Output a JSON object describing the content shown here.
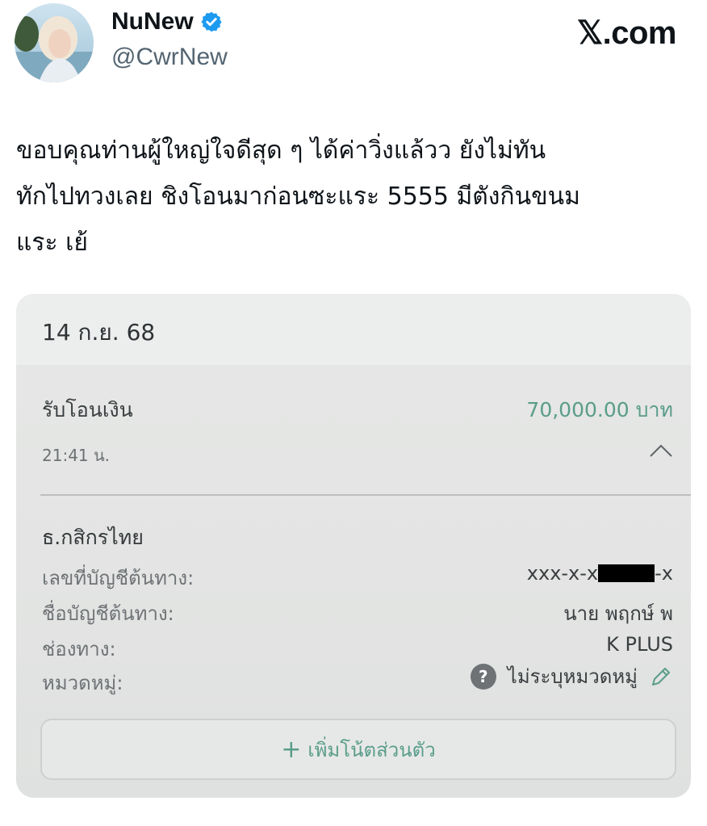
{
  "header": {
    "display_name": "NuNew",
    "handle": "@CwrNew",
    "brand": "𝕏.com",
    "verified_icon": "verified-check-icon",
    "verified_color": "#1d9bf0"
  },
  "tweet": {
    "lines": [
      "ขอบคุณท่านผู้ใหญ่ใจดีสุด ๆ  ได้ค่าวิ่งแล้วว ยังไม่ทัน",
      "ทักไปทวงเลย ชิงโอนมาก่อนซะแระ 5555 มีตังกินขนม",
      "แระ เย้"
    ]
  },
  "receipt": {
    "date": "14 ก.ย. 68",
    "title": "รับโอนเงิน",
    "amount": "70,000.00 บาท",
    "amount_color": "#5a9d8a",
    "time": "21:41 น.",
    "bank": "ธ.กสิกรไทย",
    "account_label": "เลขที่บัญชีต้นทาง:",
    "account_prefix": "xxx-x-x",
    "account_suffix": "-x",
    "name_label": "ชื่อบัญชีต้นทาง:",
    "name_value": "นาย พฤกษ์ พ",
    "channel_label": "ช่องทาง:",
    "channel_value": "K PLUS",
    "category_label": "หมวดหมู่:",
    "category_value": "ไม่ระบุหมวดหมู่",
    "question_mark": "?",
    "note_plus": "+",
    "note_button": "เพิ่มโน้ตส่วนตัว"
  }
}
